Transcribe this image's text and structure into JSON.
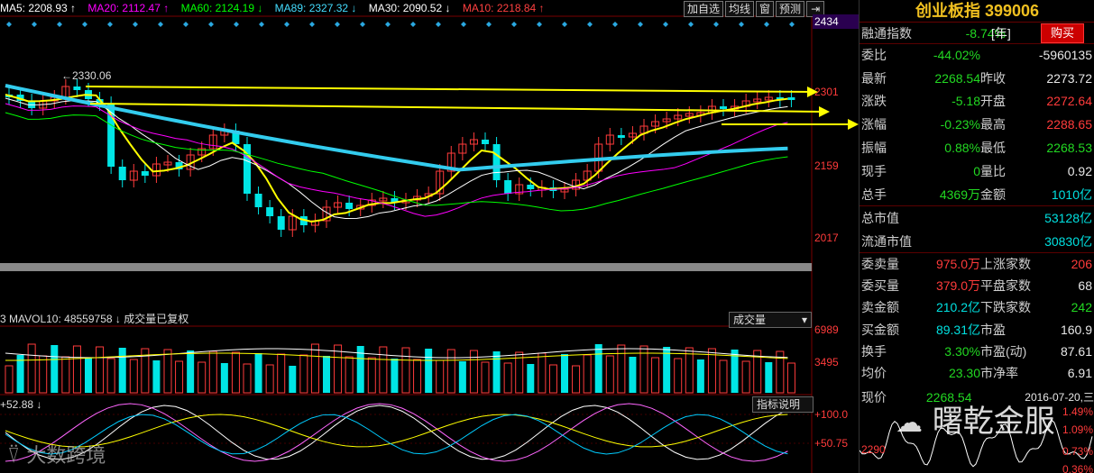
{
  "ma_header": [
    {
      "text": "MA5: 2208.93 ↑",
      "color": "#ffffff"
    },
    {
      "text": "MA20: 2112.47 ↑",
      "color": "#ff00ff"
    },
    {
      "text": "MA60: 2124.19 ↓",
      "color": "#00ff00"
    },
    {
      "text": "MA89: 2327.32 ↓",
      "color": "#44ddff"
    },
    {
      "text": "MA30: 2090.52 ↓",
      "color": "#ffffff"
    },
    {
      "text": "MA10: 2218.84 ↑",
      "color": "#ff4040"
    }
  ],
  "toolbar": {
    "add_fav": "加自选",
    "avg_line": "均线",
    "window": "窗",
    "forecast": "预测"
  },
  "price_axis": {
    "highlight": "2434",
    "labels": [
      "2301",
      "2159",
      "2017"
    ]
  },
  "peak_label": "2330.06",
  "vol_header": {
    "text": "3 MAVOL10: 48559758 ↓ 成交量已复权",
    "dropdown": "成交量",
    "axis": [
      "6989",
      "3495"
    ]
  },
  "ind_header": {
    "value": "+52.88 ↓",
    "dropdown": "指标说明",
    "axis": [
      "+100.0",
      "+50.75"
    ]
  },
  "panel": {
    "title": "创业板指 399006",
    "rows": [
      {
        "l": "融通指数",
        "v": "-8.74%",
        "v2": "[年]"
      },
      {
        "l": "委比",
        "v": "-44.02%",
        "r": "-5960135"
      },
      {
        "l": "最新",
        "v": "2268.54",
        "l2": "昨收",
        "r": "2273.72"
      },
      {
        "l": "涨跌",
        "v": "-5.18",
        "l2": "开盘",
        "r": "2272.64"
      },
      {
        "l": "涨幅",
        "v": "-0.23%",
        "l2": "最高",
        "r": "2288.65"
      },
      {
        "l": "振幅",
        "v": "0.88%",
        "l2": "最低",
        "r": "2268.53"
      },
      {
        "l": "现手",
        "v": "0",
        "l2": "量比",
        "r": "0.92"
      },
      {
        "l": "总手",
        "v": "4369万",
        "l2": "金额",
        "r": "1010亿"
      },
      {
        "l": "总市值",
        "r": "53128亿"
      },
      {
        "l": "流通市值",
        "r": "30830亿"
      },
      {
        "l": "委卖量",
        "v": "975.0万",
        "l2": "上涨家数",
        "r": "206"
      },
      {
        "l": "委买量",
        "v": "379.0万",
        "l2": "平盘家数",
        "r": "68"
      },
      {
        "l": "卖金额",
        "v": "210.2亿",
        "l2": "下跌家数",
        "r": "242"
      },
      {
        "l": "买金额",
        "v": "89.31亿",
        "l2": "市盈",
        "r": "160.9"
      },
      {
        "l": "换手",
        "v": "3.30%",
        "l2": "市盈(动)",
        "r": "87.61"
      },
      {
        "l": "均价",
        "v": "23.30",
        "l2": "市净率",
        "r": "6.91"
      }
    ],
    "buy": "购买",
    "bottom": {
      "l": "现价",
      "v": "2268.54",
      "date": "2016-07-20,三",
      "p1": "1.49%",
      "p2": "1.09%",
      "p3": "0.73%",
      "p4": "0.36%",
      "y": "2290"
    }
  },
  "watermarks": {
    "left": "大数跨境",
    "right": "曙乾金服"
  },
  "colors": {
    "up": "#ff3b3b",
    "down": "#00e5e5",
    "yellow": "#ffff00",
    "cyan": "#33ccee"
  }
}
